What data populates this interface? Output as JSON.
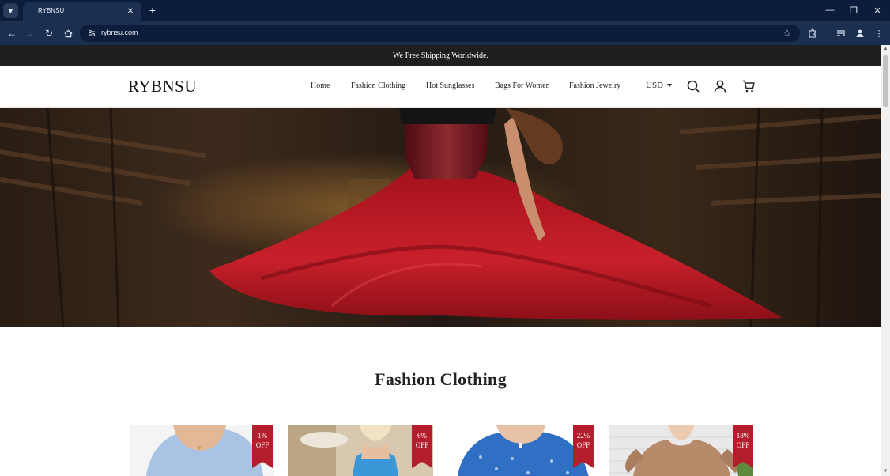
{
  "browser": {
    "tab_title": "RYBNSU",
    "url": "rybnsu.com"
  },
  "store": {
    "announcement": "We Free Shipping Worldwide.",
    "logo": "RYBNSU",
    "nav": [
      "Home",
      "Fashion Clothing",
      "Hot Sunglasses",
      "Bags For Women",
      "Fashion Jewelry"
    ],
    "currency": "USD"
  },
  "section": {
    "title": "Fashion Clothing"
  },
  "products": [
    {
      "discount": "1%",
      "off": "OFF"
    },
    {
      "discount": "6%",
      "off": "OFF"
    },
    {
      "discount": "22%",
      "off": "OFF"
    },
    {
      "discount": "18%",
      "off": "OFF"
    }
  ],
  "colors": {
    "announcement_bg": "#1f1f1f",
    "badge": "#b41d2b",
    "chrome": "#1b2f51"
  }
}
